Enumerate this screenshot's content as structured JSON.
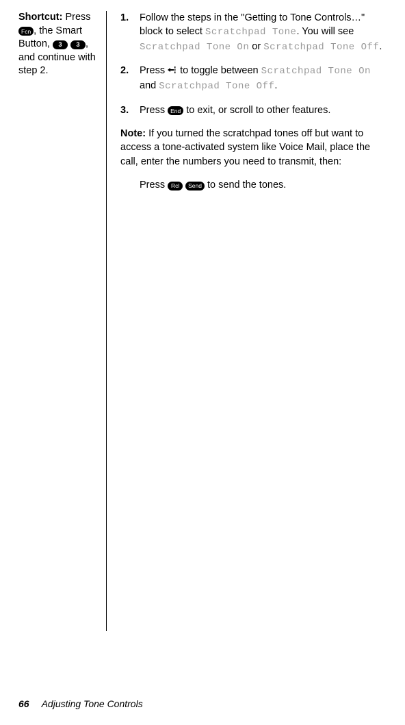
{
  "sidebar": {
    "label": "Shortcut:",
    "text1": "Press ",
    "key1": "Fcn",
    "text2": ", the Smart Button, ",
    "key2": "3",
    "key3": "3",
    "text3": ", and continue with step 2."
  },
  "steps": [
    {
      "num": "1.",
      "text1": "Follow the steps in the \"Getting to Tone Controls…\" block to select ",
      "lcd1": "Scratchpad Tone",
      "text2": ". You will see ",
      "lcd2": "Scratchpad Tone On",
      "text3": " or ",
      "lcd3": "Scratchpad Tone Off",
      "text4": "."
    },
    {
      "num": "2.",
      "text1": "Press ",
      "text2": " to toggle between ",
      "lcd1": "Scratchpad Tone On",
      "text3": " and ",
      "lcd2": "Scratchpad Tone Off",
      "text4": "."
    },
    {
      "num": "3.",
      "text1": "Press ",
      "key1": "End",
      "text2": " to exit, or scroll to other features."
    }
  ],
  "note": {
    "label": "Note:",
    "text": " If you turned the scratchpad tones off but want to access a tone-activated system like Voice Mail, place the call, enter the numbers you need to transmit, then:"
  },
  "note_cont": {
    "text1": "Press ",
    "key1": "Rcl",
    "key2": "Send",
    "text2": " to send the tones."
  },
  "footer": {
    "page": "66",
    "section": "Adjusting Tone Controls"
  }
}
